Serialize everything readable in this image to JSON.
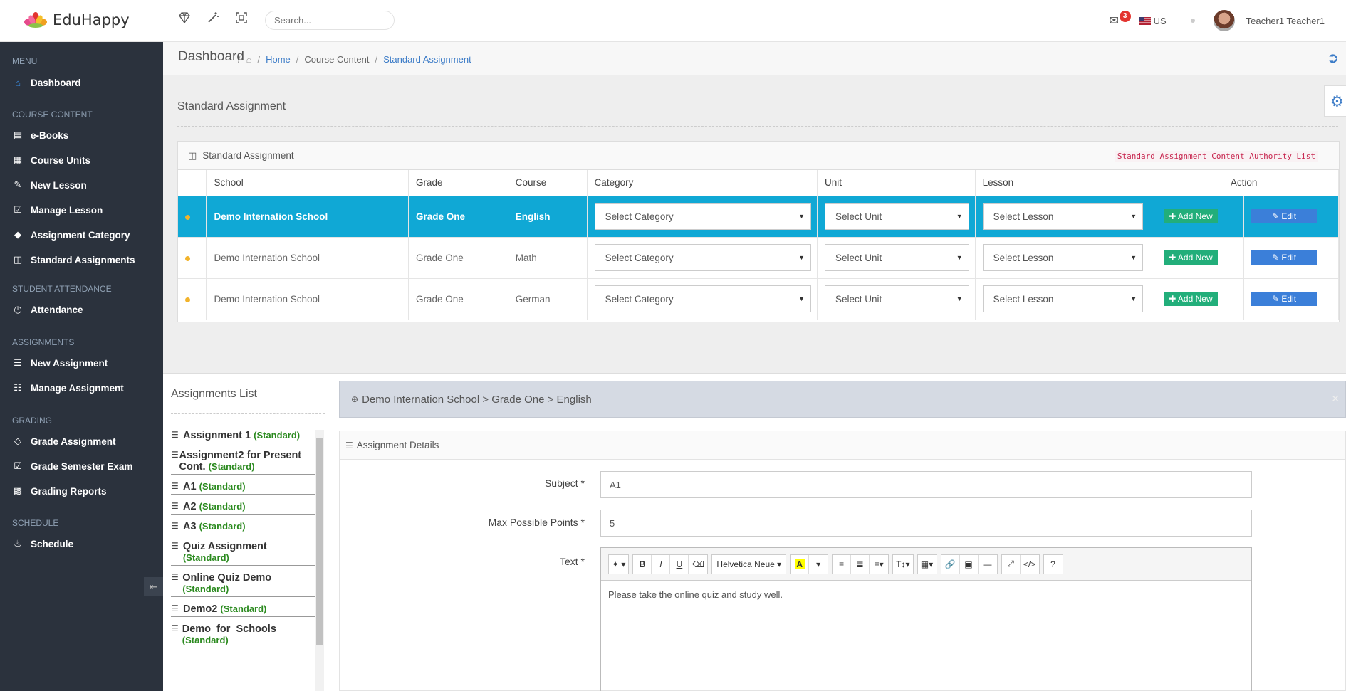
{
  "brand": {
    "name": "EduHappy"
  },
  "topbar": {
    "search_placeholder": "Search...",
    "mail_count": "3",
    "language": "US",
    "user_name": "Teacher1 Teacher1"
  },
  "sidebar": {
    "sections": [
      "MENU",
      "COURSE CONTENT",
      "STUDENT ATTENDANCE",
      "ASSIGNMENTS",
      "GRADING",
      "SCHEDULE"
    ],
    "items": [
      {
        "label": "Dashboard",
        "icon": "home-icon"
      },
      {
        "label": "e-Books",
        "icon": "book-icon"
      },
      {
        "label": "Course Units",
        "icon": "grid-icon"
      },
      {
        "label": "New Lesson",
        "icon": "pencil-icon"
      },
      {
        "label": "Manage Lesson",
        "icon": "edit-icon"
      },
      {
        "label": "Assignment Category",
        "icon": "tags-icon"
      },
      {
        "label": "Standard Assignments",
        "icon": "columns-icon"
      },
      {
        "label": "Attendance",
        "icon": "clock-icon"
      },
      {
        "label": "New Assignment",
        "icon": "tasks-icon"
      },
      {
        "label": "Manage Assignment",
        "icon": "list-icon"
      },
      {
        "label": "Grade Assignment",
        "icon": "diamond-icon"
      },
      {
        "label": "Grade Semester Exam",
        "icon": "check-square-icon"
      },
      {
        "label": "Grading Reports",
        "icon": "bar-chart-icon"
      },
      {
        "label": "Schedule",
        "icon": "bell-icon"
      }
    ]
  },
  "breadcrumb": {
    "title": "Dashboard",
    "home": "Home",
    "middle": "Course Content",
    "current": "Standard Assignment"
  },
  "standard": {
    "heading": "Standard Assignment",
    "panel_title": "Standard Assignment",
    "authority_link": "Standard Assignment Content Authority List",
    "columns": [
      "School",
      "Grade",
      "Course",
      "Category",
      "Unit",
      "Lesson",
      "Action"
    ],
    "rows": [
      {
        "school": "Demo Internation School",
        "grade": "Grade One",
        "course": "English",
        "category": "Select Category",
        "unit": "Select Unit",
        "lesson": "Select Lesson"
      },
      {
        "school": "Demo Internation School",
        "grade": "Grade One",
        "course": "Math",
        "category": "Select Category",
        "unit": "Select Unit",
        "lesson": "Select Lesson"
      },
      {
        "school": "Demo Internation School",
        "grade": "Grade One",
        "course": "German",
        "category": "Select Category",
        "unit": "Select Unit",
        "lesson": "Select Lesson"
      }
    ],
    "add_label": "Add New",
    "edit_label": "Edit"
  },
  "assignments_list": {
    "title": "Assignments List",
    "items": [
      {
        "name": "Assignment 1",
        "tag": "(Standard)"
      },
      {
        "name": "Assignment2 for Present Cont.",
        "tag": "(Standard)"
      },
      {
        "name": "A1",
        "tag": "(Standard)"
      },
      {
        "name": "A2",
        "tag": "(Standard)"
      },
      {
        "name": "A3",
        "tag": "(Standard)"
      },
      {
        "name": "Quiz Assignment",
        "tag": "(Standard)"
      },
      {
        "name": "Online Quiz Demo",
        "tag": "(Standard)"
      },
      {
        "name": "Demo2",
        "tag": "(Standard)"
      },
      {
        "name": "Demo_for_Schools",
        "tag": "(Standard)"
      }
    ]
  },
  "details": {
    "path": "Demo Internation School > Grade One > English",
    "title": "Assignment Details",
    "subject_label": "Subject *",
    "subject_value": "A1",
    "points_label": "Max Possible Points *",
    "points_value": "5",
    "text_label": "Text *",
    "font_name": "Helvetica Neue",
    "body_text": "Please take the online quiz and study well."
  },
  "colors": {
    "sidebar": "#2b323d",
    "selected_row": "#10a8d5",
    "add_button": "#22ae7a",
    "edit_button": "#3b7fd9",
    "link": "#3b7bc7"
  }
}
